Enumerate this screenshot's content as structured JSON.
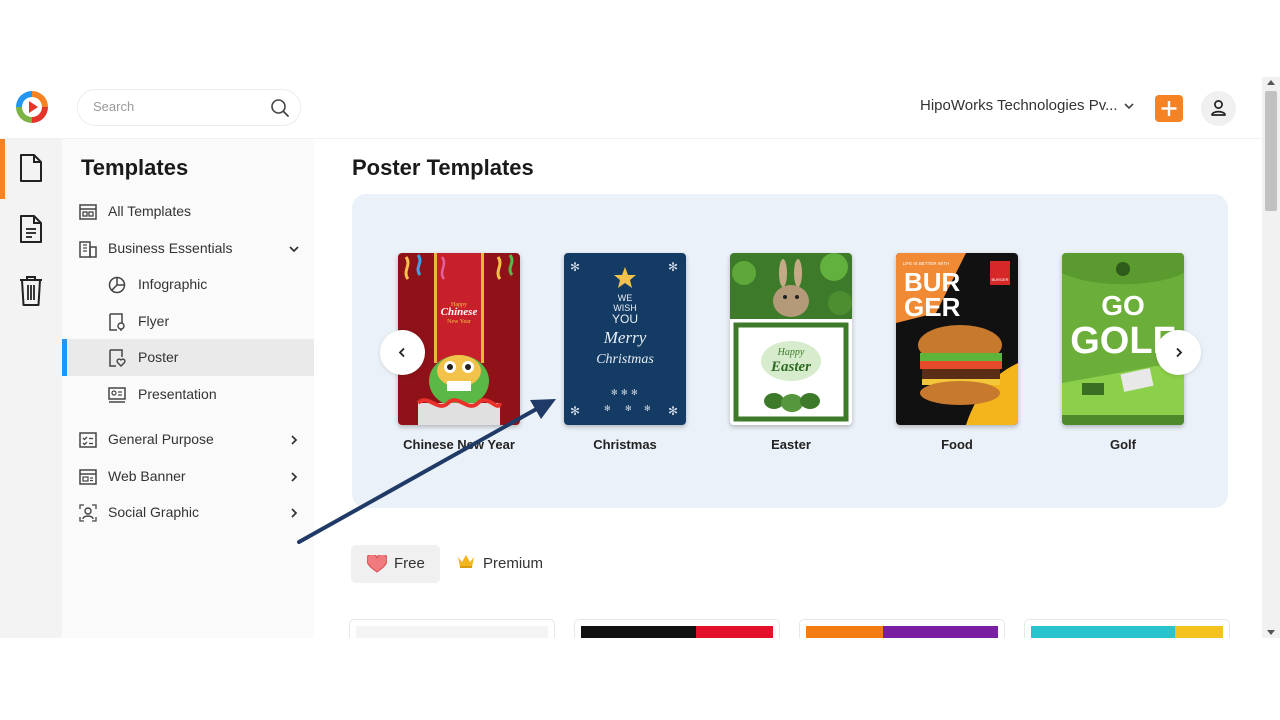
{
  "header": {
    "search_placeholder": "Search",
    "org_name": "HipoWorks Technologies Pv...",
    "accent_color": "#f58223"
  },
  "rail": {
    "items": [
      {
        "icon": "document-icon",
        "active": true
      },
      {
        "icon": "text-document-icon",
        "active": false
      },
      {
        "icon": "trash-icon",
        "active": false
      }
    ]
  },
  "sidebar": {
    "title": "Templates",
    "items": [
      {
        "label": "All Templates",
        "icon": "layout-icon"
      },
      {
        "label": "Business Essentials",
        "icon": "building-icon",
        "expanded": true
      },
      {
        "label": "Infographic",
        "icon": "pie-chart-icon"
      },
      {
        "label": "Flyer",
        "icon": "flyer-icon"
      },
      {
        "label": "Poster",
        "icon": "poster-icon",
        "active": true
      },
      {
        "label": "Presentation",
        "icon": "presentation-icon"
      },
      {
        "label": "General Purpose",
        "icon": "checklist-icon"
      },
      {
        "label": "Web Banner",
        "icon": "web-banner-icon"
      },
      {
        "label": "Social Graphic",
        "icon": "social-icon"
      }
    ]
  },
  "main": {
    "title": "Poster Templates",
    "categories": [
      {
        "label": "Chinese New Year",
        "thumb_text": [
          "Happy",
          "Chinese",
          "New Year"
        ]
      },
      {
        "label": "Christmas",
        "thumb_text": [
          "WE",
          "WISH",
          "YOU",
          "Merry",
          "Christmas"
        ]
      },
      {
        "label": "Easter",
        "thumb_text": [
          "Happy",
          "Easter"
        ]
      },
      {
        "label": "Food",
        "thumb_text": [
          "LIFE IS BETTER WITH",
          "BUR",
          "GER",
          "BURGER"
        ]
      },
      {
        "label": "Golf",
        "thumb_text": [
          "GO",
          "GOLF"
        ]
      }
    ],
    "filters": {
      "free_label": "Free",
      "premium_label": "Premium"
    }
  }
}
